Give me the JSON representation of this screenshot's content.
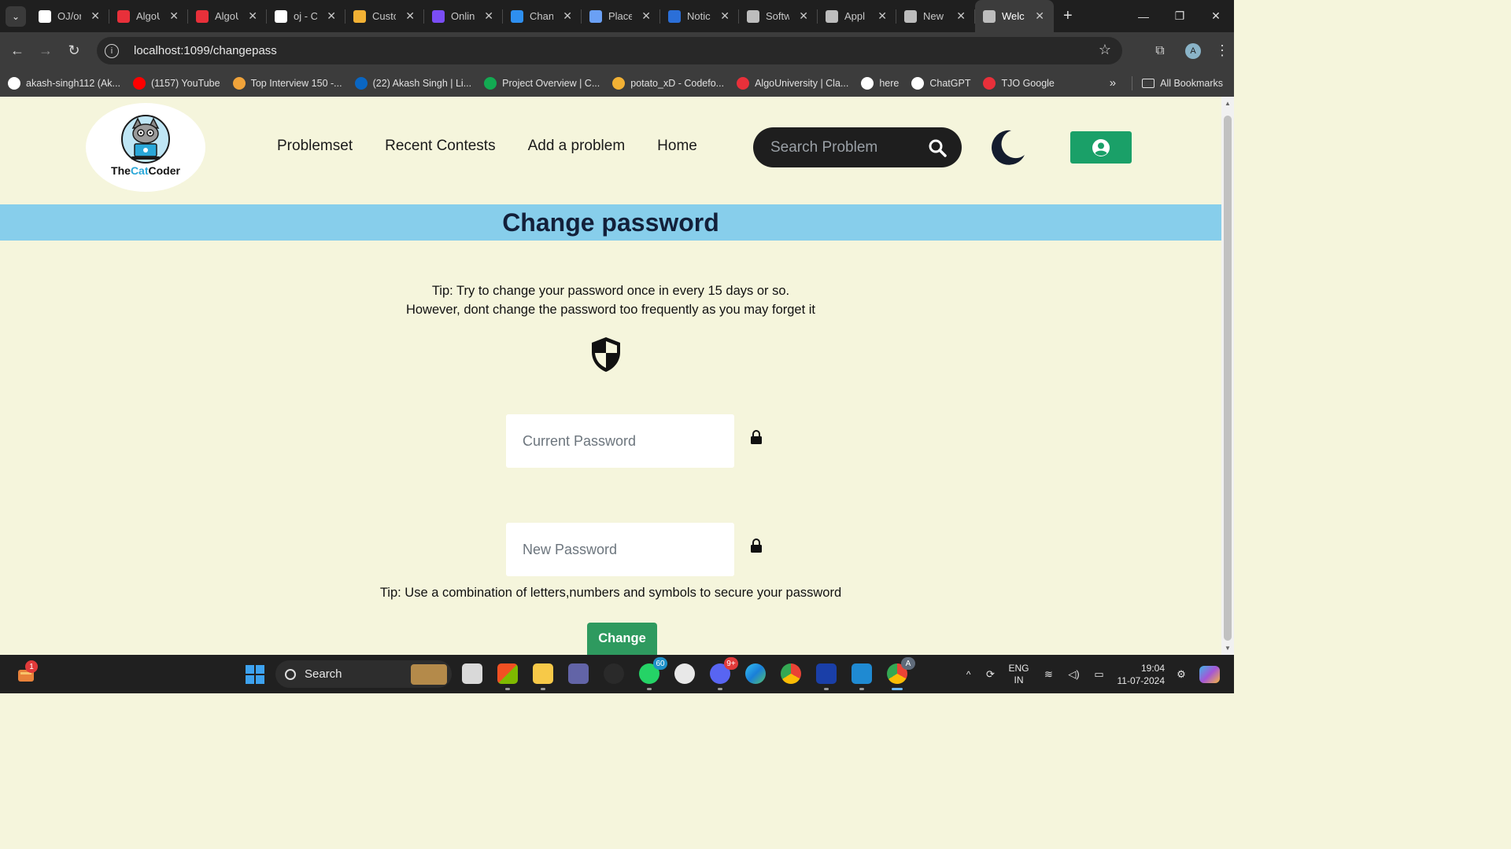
{
  "browser": {
    "tabs": [
      {
        "title": "OJ/or",
        "favicon": "github-icon",
        "color": "#ffffff"
      },
      {
        "title": "AlgoU",
        "favicon": "algouniversity-icon",
        "color": "#e8303a"
      },
      {
        "title": "AlgoU",
        "favicon": "algouniversity-icon",
        "color": "#e8303a"
      },
      {
        "title": "oj - C",
        "favicon": "vercel-icon",
        "color": "#ffffff"
      },
      {
        "title": "Custo",
        "favicon": "codeforces-icon",
        "color": "#f2b134"
      },
      {
        "title": "Onlin",
        "favicon": "online-icon",
        "color": "#7a4df5"
      },
      {
        "title": "Chan",
        "favicon": "app-icon",
        "color": "#2e8ff0"
      },
      {
        "title": "Place",
        "favicon": "docs-icon",
        "color": "#6aa0f5"
      },
      {
        "title": "Notic",
        "favicon": "pin-icon",
        "color": "#2b6fd8"
      },
      {
        "title": "Softw",
        "favicon": "globe-icon",
        "color": "#bdbdbd"
      },
      {
        "title": "Appl",
        "favicon": "globe-icon",
        "color": "#bdbdbd"
      },
      {
        "title": "New",
        "favicon": "chrome-icon",
        "color": "#bdbdbd"
      },
      {
        "title": "Welc",
        "favicon": "globe-icon",
        "color": "#bdbdbd",
        "active": true
      }
    ],
    "url": "localhost:1099/changepass",
    "profile_initial": "A",
    "bookmarks": [
      {
        "label": "akash-singh112 (Ak...",
        "color": "#ffffff"
      },
      {
        "label": "(1157) YouTube",
        "color": "#ff0000"
      },
      {
        "label": "Top Interview 150 -...",
        "color": "#f0a33a"
      },
      {
        "label": "(22) Akash Singh | Li...",
        "color": "#0a66c2"
      },
      {
        "label": "Project Overview | C...",
        "color": "#13aa52"
      },
      {
        "label": "potato_xD - Codefo...",
        "color": "#f2b134"
      },
      {
        "label": "AlgoUniversity | Cla...",
        "color": "#e8303a"
      },
      {
        "label": "here",
        "color": "#ffffff"
      },
      {
        "label": "ChatGPT",
        "color": "#ffffff"
      },
      {
        "label": "TJO Google",
        "color": "#e8303a"
      }
    ],
    "all_bookmarks": "All Bookmarks"
  },
  "site": {
    "logo": {
      "text_a": "The",
      "text_b": "Cat",
      "text_c": "Coder"
    },
    "nav": [
      "Problemset",
      "Recent Contests",
      "Add a problem",
      "Home"
    ],
    "search_placeholder": "Search Problem",
    "accent": "#1aa068"
  },
  "change_password": {
    "title": "Change password",
    "tip_line1": "Tip: Try to change your password once in every 15 days or so.",
    "tip_line2": "However, dont change the password too frequently as you may forget it",
    "current_placeholder": "Current Password",
    "new_placeholder": "New Password",
    "tip_secure": "Tip: Use a combination of letters,numbers and symbols to secure your password",
    "button": "Change"
  },
  "taskbar": {
    "widget_badge": "1",
    "search_label": "Search",
    "whatsapp_badge": "60",
    "discord_badge": "9+",
    "chrome_profile": "A",
    "lang_line1": "ENG",
    "lang_line2": "IN",
    "time": "19:04",
    "date": "11-07-2024"
  }
}
